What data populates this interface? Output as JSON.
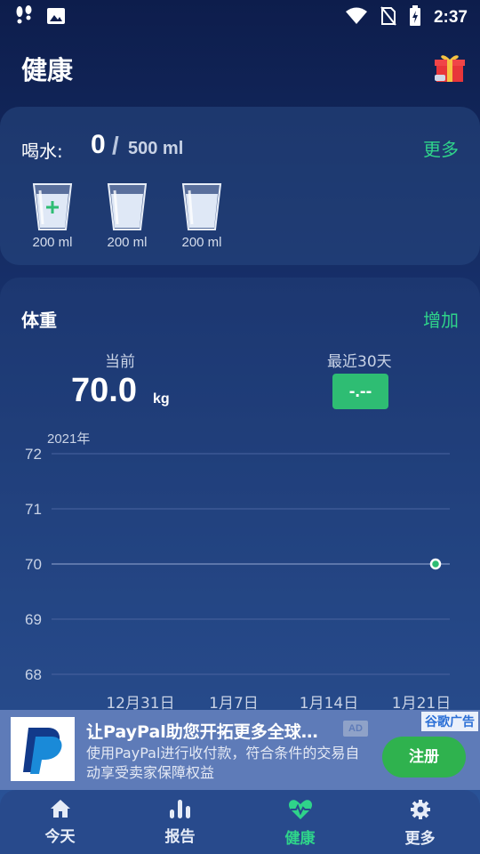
{
  "status_bar": {
    "time": "2:37"
  },
  "header": {
    "title": "健康"
  },
  "water": {
    "label": "喝水:",
    "current": "0",
    "separator": "/",
    "goal": "500 ml",
    "more": "更多",
    "cups": [
      {
        "amount": "200 ml",
        "has_add": true
      },
      {
        "amount": "200 ml",
        "has_add": false
      },
      {
        "amount": "200 ml",
        "has_add": false
      }
    ]
  },
  "weight": {
    "title": "体重",
    "add": "增加",
    "current_label": "当前",
    "current_value": "70.0",
    "unit": "kg",
    "recent_label": "最近30天",
    "recent_value": "-.--"
  },
  "chart_data": {
    "type": "scatter",
    "year_label": "2021年",
    "y_ticks": [
      "72",
      "71",
      "70",
      "69",
      "68"
    ],
    "x_ticks": [
      "12月31日",
      "1月7日",
      "1月14日",
      "1月21日"
    ],
    "ylim": [
      68,
      72
    ],
    "points": [
      {
        "x": "1月22日",
        "y": 70
      }
    ],
    "reference_y": 70,
    "grid": true
  },
  "ad": {
    "title": "让PayPal助您开拓更多全球…",
    "badge": "AD",
    "description": "使用PayPal进行收付款，符合条件的交易自动享受卖家保障权益",
    "tag": "谷歌广告",
    "button": "注册"
  },
  "tabs": [
    {
      "label": "今天",
      "icon": "home-icon",
      "active": false
    },
    {
      "label": "报告",
      "icon": "bar-chart-icon",
      "active": false
    },
    {
      "label": "健康",
      "icon": "heart-pulse-icon",
      "active": true
    },
    {
      "label": "更多",
      "icon": "gear-icon",
      "active": false
    }
  ],
  "colors": {
    "accent_green": "#2fd38a",
    "badge_green": "#2ebd73",
    "ad_button": "#2fb24e",
    "tab_bar": "#284a8c"
  }
}
